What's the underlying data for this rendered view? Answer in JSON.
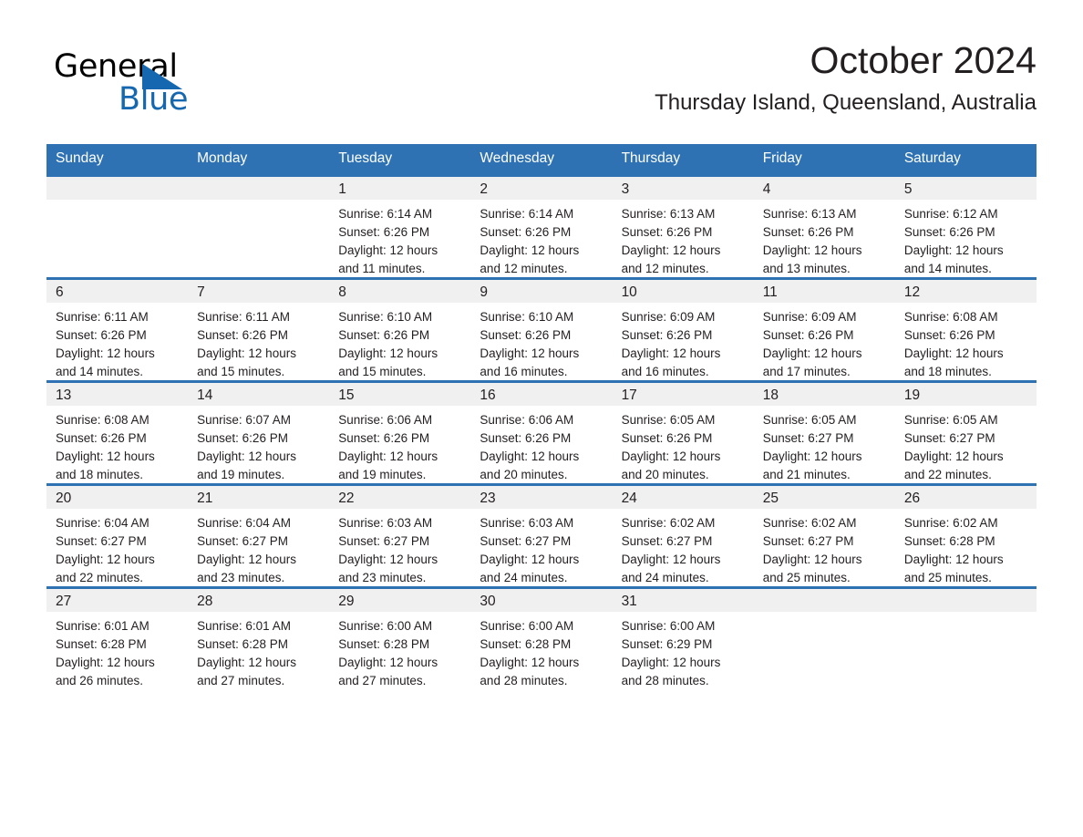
{
  "brand": {
    "name_part1": "General",
    "name_part2": "Blue",
    "triangle_icon": "triangle-icon",
    "accent_color": "#1568b0"
  },
  "header": {
    "title": "October 2024",
    "subtitle": "Thursday Island, Queensland, Australia"
  },
  "theme": {
    "header_blue": "#2e72b4",
    "day_band_gray": "#f0f0f0",
    "text_color": "#231f20"
  },
  "calendar": {
    "weekday_headers": [
      "Sunday",
      "Monday",
      "Tuesday",
      "Wednesday",
      "Thursday",
      "Friday",
      "Saturday"
    ],
    "weeks": [
      [
        {
          "day": "",
          "sunrise": "",
          "sunset": "",
          "daylight1": "",
          "daylight2": "",
          "empty": true
        },
        {
          "day": "",
          "sunrise": "",
          "sunset": "",
          "daylight1": "",
          "daylight2": "",
          "empty": true
        },
        {
          "day": "1",
          "sunrise": "Sunrise: 6:14 AM",
          "sunset": "Sunset: 6:26 PM",
          "daylight1": "Daylight: 12 hours",
          "daylight2": "and 11 minutes."
        },
        {
          "day": "2",
          "sunrise": "Sunrise: 6:14 AM",
          "sunset": "Sunset: 6:26 PM",
          "daylight1": "Daylight: 12 hours",
          "daylight2": "and 12 minutes."
        },
        {
          "day": "3",
          "sunrise": "Sunrise: 6:13 AM",
          "sunset": "Sunset: 6:26 PM",
          "daylight1": "Daylight: 12 hours",
          "daylight2": "and 12 minutes."
        },
        {
          "day": "4",
          "sunrise": "Sunrise: 6:13 AM",
          "sunset": "Sunset: 6:26 PM",
          "daylight1": "Daylight: 12 hours",
          "daylight2": "and 13 minutes."
        },
        {
          "day": "5",
          "sunrise": "Sunrise: 6:12 AM",
          "sunset": "Sunset: 6:26 PM",
          "daylight1": "Daylight: 12 hours",
          "daylight2": "and 14 minutes."
        }
      ],
      [
        {
          "day": "6",
          "sunrise": "Sunrise: 6:11 AM",
          "sunset": "Sunset: 6:26 PM",
          "daylight1": "Daylight: 12 hours",
          "daylight2": "and 14 minutes."
        },
        {
          "day": "7",
          "sunrise": "Sunrise: 6:11 AM",
          "sunset": "Sunset: 6:26 PM",
          "daylight1": "Daylight: 12 hours",
          "daylight2": "and 15 minutes."
        },
        {
          "day": "8",
          "sunrise": "Sunrise: 6:10 AM",
          "sunset": "Sunset: 6:26 PM",
          "daylight1": "Daylight: 12 hours",
          "daylight2": "and 15 minutes."
        },
        {
          "day": "9",
          "sunrise": "Sunrise: 6:10 AM",
          "sunset": "Sunset: 6:26 PM",
          "daylight1": "Daylight: 12 hours",
          "daylight2": "and 16 minutes."
        },
        {
          "day": "10",
          "sunrise": "Sunrise: 6:09 AM",
          "sunset": "Sunset: 6:26 PM",
          "daylight1": "Daylight: 12 hours",
          "daylight2": "and 16 minutes."
        },
        {
          "day": "11",
          "sunrise": "Sunrise: 6:09 AM",
          "sunset": "Sunset: 6:26 PM",
          "daylight1": "Daylight: 12 hours",
          "daylight2": "and 17 minutes."
        },
        {
          "day": "12",
          "sunrise": "Sunrise: 6:08 AM",
          "sunset": "Sunset: 6:26 PM",
          "daylight1": "Daylight: 12 hours",
          "daylight2": "and 18 minutes."
        }
      ],
      [
        {
          "day": "13",
          "sunrise": "Sunrise: 6:08 AM",
          "sunset": "Sunset: 6:26 PM",
          "daylight1": "Daylight: 12 hours",
          "daylight2": "and 18 minutes."
        },
        {
          "day": "14",
          "sunrise": "Sunrise: 6:07 AM",
          "sunset": "Sunset: 6:26 PM",
          "daylight1": "Daylight: 12 hours",
          "daylight2": "and 19 minutes."
        },
        {
          "day": "15",
          "sunrise": "Sunrise: 6:06 AM",
          "sunset": "Sunset: 6:26 PM",
          "daylight1": "Daylight: 12 hours",
          "daylight2": "and 19 minutes."
        },
        {
          "day": "16",
          "sunrise": "Sunrise: 6:06 AM",
          "sunset": "Sunset: 6:26 PM",
          "daylight1": "Daylight: 12 hours",
          "daylight2": "and 20 minutes."
        },
        {
          "day": "17",
          "sunrise": "Sunrise: 6:05 AM",
          "sunset": "Sunset: 6:26 PM",
          "daylight1": "Daylight: 12 hours",
          "daylight2": "and 20 minutes."
        },
        {
          "day": "18",
          "sunrise": "Sunrise: 6:05 AM",
          "sunset": "Sunset: 6:27 PM",
          "daylight1": "Daylight: 12 hours",
          "daylight2": "and 21 minutes."
        },
        {
          "day": "19",
          "sunrise": "Sunrise: 6:05 AM",
          "sunset": "Sunset: 6:27 PM",
          "daylight1": "Daylight: 12 hours",
          "daylight2": "and 22 minutes."
        }
      ],
      [
        {
          "day": "20",
          "sunrise": "Sunrise: 6:04 AM",
          "sunset": "Sunset: 6:27 PM",
          "daylight1": "Daylight: 12 hours",
          "daylight2": "and 22 minutes."
        },
        {
          "day": "21",
          "sunrise": "Sunrise: 6:04 AM",
          "sunset": "Sunset: 6:27 PM",
          "daylight1": "Daylight: 12 hours",
          "daylight2": "and 23 minutes."
        },
        {
          "day": "22",
          "sunrise": "Sunrise: 6:03 AM",
          "sunset": "Sunset: 6:27 PM",
          "daylight1": "Daylight: 12 hours",
          "daylight2": "and 23 minutes."
        },
        {
          "day": "23",
          "sunrise": "Sunrise: 6:03 AM",
          "sunset": "Sunset: 6:27 PM",
          "daylight1": "Daylight: 12 hours",
          "daylight2": "and 24 minutes."
        },
        {
          "day": "24",
          "sunrise": "Sunrise: 6:02 AM",
          "sunset": "Sunset: 6:27 PM",
          "daylight1": "Daylight: 12 hours",
          "daylight2": "and 24 minutes."
        },
        {
          "day": "25",
          "sunrise": "Sunrise: 6:02 AM",
          "sunset": "Sunset: 6:27 PM",
          "daylight1": "Daylight: 12 hours",
          "daylight2": "and 25 minutes."
        },
        {
          "day": "26",
          "sunrise": "Sunrise: 6:02 AM",
          "sunset": "Sunset: 6:28 PM",
          "daylight1": "Daylight: 12 hours",
          "daylight2": "and 25 minutes."
        }
      ],
      [
        {
          "day": "27",
          "sunrise": "Sunrise: 6:01 AM",
          "sunset": "Sunset: 6:28 PM",
          "daylight1": "Daylight: 12 hours",
          "daylight2": "and 26 minutes."
        },
        {
          "day": "28",
          "sunrise": "Sunrise: 6:01 AM",
          "sunset": "Sunset: 6:28 PM",
          "daylight1": "Daylight: 12 hours",
          "daylight2": "and 27 minutes."
        },
        {
          "day": "29",
          "sunrise": "Sunrise: 6:00 AM",
          "sunset": "Sunset: 6:28 PM",
          "daylight1": "Daylight: 12 hours",
          "daylight2": "and 27 minutes."
        },
        {
          "day": "30",
          "sunrise": "Sunrise: 6:00 AM",
          "sunset": "Sunset: 6:28 PM",
          "daylight1": "Daylight: 12 hours",
          "daylight2": "and 28 minutes."
        },
        {
          "day": "31",
          "sunrise": "Sunrise: 6:00 AM",
          "sunset": "Sunset: 6:29 PM",
          "daylight1": "Daylight: 12 hours",
          "daylight2": "and 28 minutes."
        },
        {
          "day": "",
          "sunrise": "",
          "sunset": "",
          "daylight1": "",
          "daylight2": "",
          "empty": true
        },
        {
          "day": "",
          "sunrise": "",
          "sunset": "",
          "daylight1": "",
          "daylight2": "",
          "empty": true
        }
      ]
    ]
  }
}
